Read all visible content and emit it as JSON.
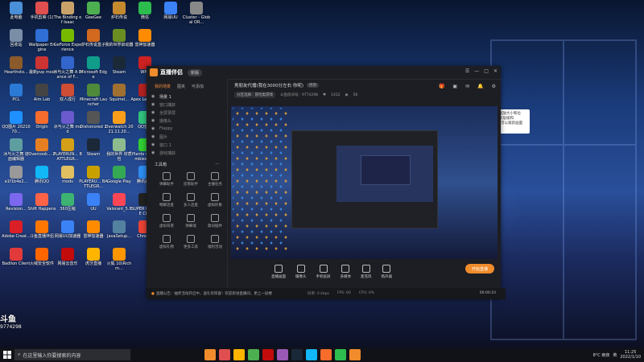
{
  "desktop": {
    "icons": [
      {
        "label": "此电脑",
        "color": "#4a90d9"
      },
      {
        "label": "手机剪映 (1)",
        "color": "#e04f4f"
      },
      {
        "label": "The Binding of Isaac",
        "color": "#c9a26a"
      },
      {
        "label": "GeeGee",
        "color": "#4caf50"
      },
      {
        "label": "炉石传说",
        "color": "#c68a2e"
      },
      {
        "label": "微信",
        "color": "#2dbd4e"
      },
      {
        "label": "网易UU",
        "color": "#3b82f6"
      },
      {
        "label": "Cluster - Global OR...",
        "color": "#888888"
      },
      {
        "label": "回收站",
        "color": "#7a8ea8"
      },
      {
        "label": "Wallpaper Engine",
        "color": "#2f6fd6"
      },
      {
        "label": "GeForce Experience",
        "color": "#76b900"
      },
      {
        "label": "炉石传说盒子",
        "color": "#d2691e"
      },
      {
        "label": "我的世界启动器",
        "color": "#6b8e23"
      },
      {
        "label": "雷神加速器",
        "color": "#ff8c00"
      },
      {
        "label": "Hearthsto...",
        "color": "#8b5a2b"
      },
      {
        "label": "最新pvp mod",
        "color": "#cc3333"
      },
      {
        "label": "冰与火之舞 A Dance of F...",
        "color": "#3366cc"
      },
      {
        "label": "Microsoft Edge",
        "color": "#0f9d8a"
      },
      {
        "label": "Steam",
        "color": "#1b2838"
      },
      {
        "label": "WPS",
        "color": "#cc2222"
      },
      {
        "label": "PCL",
        "color": "#2b7bd6"
      },
      {
        "label": "Aim Lab",
        "color": "#444444"
      },
      {
        "label": "双人成行",
        "color": "#cf4c35"
      },
      {
        "label": "Minecraft Launcher",
        "color": "#4e8a3a"
      },
      {
        "label": "Squirrel...",
        "color": "#a07030"
      },
      {
        "label": "Apex Legends",
        "color": "#b22222"
      },
      {
        "label": "QQ图片 2021070...",
        "color": "#1e90ff"
      },
      {
        "label": "Origin",
        "color": "#f56c2d"
      },
      {
        "label": "冰与火之舞 mod",
        "color": "#6a5acd"
      },
      {
        "label": "Dishonored 2",
        "color": "#555555"
      },
      {
        "label": "Overwatch 2021.11.20...",
        "color": "#f99e1a"
      },
      {
        "label": "QQ音乐",
        "color": "#31c27c"
      },
      {
        "label": "冰与火之舞 谱面编辑器",
        "color": "#5f9ea0"
      },
      {
        "label": "Overcook... 2",
        "color": "#e67e22"
      },
      {
        "label": "PLAYERUN... BATTLEGR...",
        "color": "#d4a017"
      },
      {
        "label": "Steam",
        "color": "#1b2838"
      },
      {
        "label": "我的世界 材质包",
        "color": "#8fbc8f"
      },
      {
        "label": "Plants vs. Zombies G...",
        "color": "#32cd32"
      },
      {
        "label": "e1f1b4e2...",
        "color": "#999999"
      },
      {
        "label": "腾讯QQ",
        "color": "#12b7f5"
      },
      {
        "label": "mods",
        "color": "#e0c060"
      },
      {
        "label": "PLAYERU... BATTLEGR...",
        "color": "#c8a000"
      },
      {
        "label": "Google Play",
        "color": "#34a853"
      },
      {
        "label": "腾讯会议",
        "color": "#2d8cf0"
      },
      {
        "label": "Revision...",
        "color": "#7b68ee"
      },
      {
        "label": "Shift Happens",
        "color": "#ff6347"
      },
      {
        "label": "360压缩",
        "color": "#3cb371"
      },
      {
        "label": "UU",
        "color": "#3b82f6"
      },
      {
        "label": "Valorant_5.8",
        "color": "#ff4655"
      },
      {
        "label": "SUPER PEOPLE CBT",
        "color": "#222222"
      },
      {
        "label": "Adobe Creat...",
        "color": "#da1f26"
      },
      {
        "label": "斗鱼直播伴侣",
        "color": "#ff7700"
      },
      {
        "label": "网易UU加速器",
        "color": "#3b82f6"
      },
      {
        "label": "雷神加速器",
        "color": "#ff8c00"
      },
      {
        "label": "JavaSetup...",
        "color": "#5382a1"
      },
      {
        "label": "Chrome",
        "color": "#ea4335"
      },
      {
        "label": "Badlion Client",
        "color": "#e23a3a"
      },
      {
        "label": "火绒安全软件",
        "color": "#ff6600"
      },
      {
        "label": "网易云音乐",
        "color": "#c20c0c"
      },
      {
        "label": "虎牙直播",
        "color": "#ffb400"
      },
      {
        "label": "火狐 10(Richm...",
        "color": "#ff9500"
      }
    ],
    "watermark": {
      "logo": "斗鱼",
      "room": "9774298"
    }
  },
  "taskbar": {
    "search_placeholder": "在这里输入你要搜索的内容",
    "apps": [
      "#f08c2b",
      "#e04f4f",
      "#ffb400",
      "#4caf50",
      "#c20c0c",
      "#9b59b6",
      "#1b2838",
      "#12b7f5",
      "#f56c2d",
      "#2dbd4e",
      "#f08c2b"
    ],
    "tray": {
      "weather": "8°C 雨夜",
      "lang": "英",
      "time": "11:25",
      "date": "2022/1/10"
    }
  },
  "app": {
    "name": "直播伴侣",
    "version_pill": "新版",
    "tabs": [
      "我的场景",
      "图夹",
      "可添加"
    ],
    "scene_items": [
      {
        "label": "场景 1",
        "selected": true
      },
      {
        "label": "窗口捕获",
        "selected": false
      },
      {
        "label": "全屏录屏",
        "selected": false
      },
      {
        "label": "摄像头",
        "selected": false
      },
      {
        "label": "Flappy",
        "selected": false
      },
      {
        "label": "图片",
        "selected": false
      },
      {
        "label": "窗口 1",
        "selected": false
      },
      {
        "label": "游戏捕获",
        "selected": false
      }
    ],
    "tools_title": "工具箱",
    "tools_more": "···",
    "tools": [
      "弹幕助手",
      "房管助手",
      "主播任务",
      "畅聊连麦",
      "多人连麦",
      "虚拟形象",
      "虚拟背景",
      "弹幕墙",
      "歌词插件",
      "虚拟礼物",
      "更多工具",
      "福利活动"
    ],
    "room": {
      "title": "男朋友代播(我在3000分左右 你呢)",
      "edit_label": "修改",
      "category": "分区选择：冒险类游戏",
      "room_label": "斗鱼房间号：9774298",
      "fans": "1412",
      "online": "56"
    },
    "controls": [
      "直播画面",
      "摄像头",
      "手机投屏",
      "多媒体",
      "麦克风",
      "扬声器"
    ],
    "live_button": "开始直播",
    "status": {
      "notice": "直播公告：抽奖活动开启中，送礼有惊喜！欢迎新进直播间，更上一层楼",
      "bitrate": "码率: 0 kbps",
      "fps": "FPS: 60",
      "cpu": "CPU: 0%",
      "timer": "00:00:10"
    },
    "tooltip": "鼠标左键拖拽，拉伸或缩放大小和位置，右键菜单可更换提示层级和Alt+Shift锁定键拖进场可以裁剪画面 Ctrl+V粘贴文本/图片"
  }
}
